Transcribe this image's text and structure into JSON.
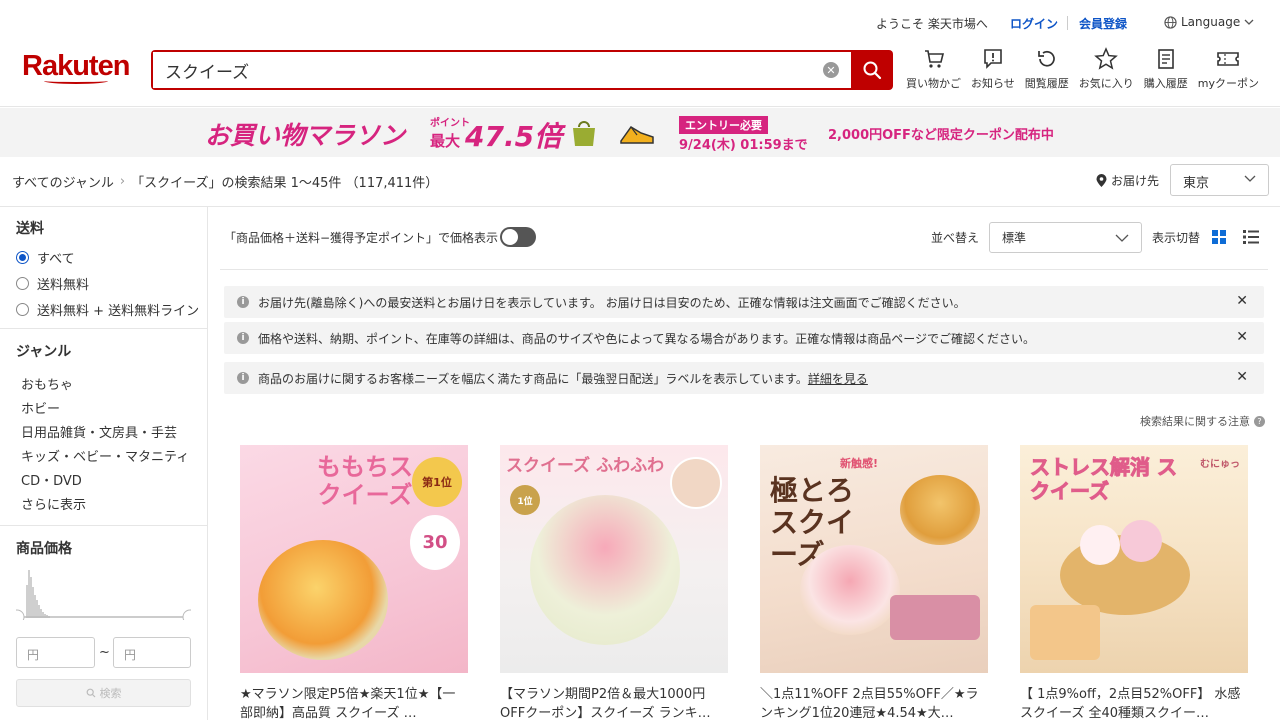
{
  "header": {
    "welcome": "ようこそ 楽天市場へ",
    "login": "ログイン",
    "register": "会員登録",
    "language": "Language",
    "logo": "Rakuten",
    "search_value": "スクイーズ",
    "nav": [
      {
        "label": "買い物かご",
        "icon": "cart-icon"
      },
      {
        "label": "お知らせ",
        "icon": "notice-icon"
      },
      {
        "label": "閲覧履歴",
        "icon": "history-icon"
      },
      {
        "label": "お気に入り",
        "icon": "star-icon"
      },
      {
        "label": "購入履歴",
        "icon": "receipt-icon"
      },
      {
        "label": "myクーポン",
        "icon": "coupon-icon"
      }
    ]
  },
  "banner": {
    "title": "お買い物マラソン",
    "point_small": "ポイント",
    "point_max": "最大",
    "rate": "47.5倍",
    "entry": "エントリー必要",
    "date": "9/24(木) 01:59まで",
    "coupon": "2,000円OFFなど限定クーポン配布中",
    "colors": {
      "accent": "#d6247f"
    }
  },
  "breadcrumb": {
    "root": "すべてのジャンル",
    "result": "「スクイーズ」の検索結果 1〜45件 （117,411件）"
  },
  "delivery": {
    "label": "お届け先",
    "pref": "東京"
  },
  "sidebar": {
    "shipping_title": "送料",
    "shipping_options": [
      "すべて",
      "送料無料",
      "送料無料 + 送料無料ライン"
    ],
    "genre_title": "ジャンル",
    "genres": [
      "おもちゃ",
      "ホビー",
      "日用品雑貨・文房具・手芸",
      "キッズ・ベビー・マタニティ",
      "CD・DVD",
      "さらに表示"
    ],
    "price_title": "商品価格",
    "price_min_placeholder": "円",
    "price_max_placeholder": "円",
    "tilde": "~",
    "search_button": "検索"
  },
  "toolbar": {
    "price_display": "「商品価格＋送料−獲得予定ポイント」で価格表示",
    "sort_label": "並べ替え",
    "sort_value": "標準",
    "view_label": "表示切替"
  },
  "notices": [
    {
      "text": "お届け先(離島除く)への最安送料とお届け日を表示しています。 お届け日は目安のため、正確な情報は注文画面でご確認ください。"
    },
    {
      "text": "価格や送料、納期、ポイント、在庫等の詳細は、商品のサイズや色によって異なる場合があります。正確な情報は商品ページでご確認ください。"
    },
    {
      "text": "商品のお届けに関するお客様ニーズを幅広く満たす商品に「最強翌日配送」ラベルを表示しています。",
      "link": "詳細を見る"
    }
  ],
  "caution": "検索結果に関する注意",
  "products": [
    {
      "name": "★マラソン限定P5倍★楽天1位★【一部即納】高品質 スクイーズ …",
      "img_text": "ももちスクイーズ",
      "badge": "第1位",
      "color": "#f7c6d6"
    },
    {
      "name": "【マラソン期間P2倍＆最大1000円OFFクーポン】スクイーズ ランキ…",
      "img_text": "スクイーズ ふわふわ",
      "badge": "1位",
      "color": "#f5d0d8"
    },
    {
      "name": "＼1点11%OFF 2点目55%OFF／★ランキング1位20連冠★4.54★大…",
      "img_text": "極とろ スクイーズ",
      "badge": "新触感!",
      "color": "#f3dccb"
    },
    {
      "name": "【 1点9%off，2点目52%OFF】 水感スクイーズ 全40種類スクイー…",
      "img_text": "ストレス解消 スクイーズ",
      "badge": "むにゅっ",
      "color": "#f6e3c6"
    }
  ]
}
